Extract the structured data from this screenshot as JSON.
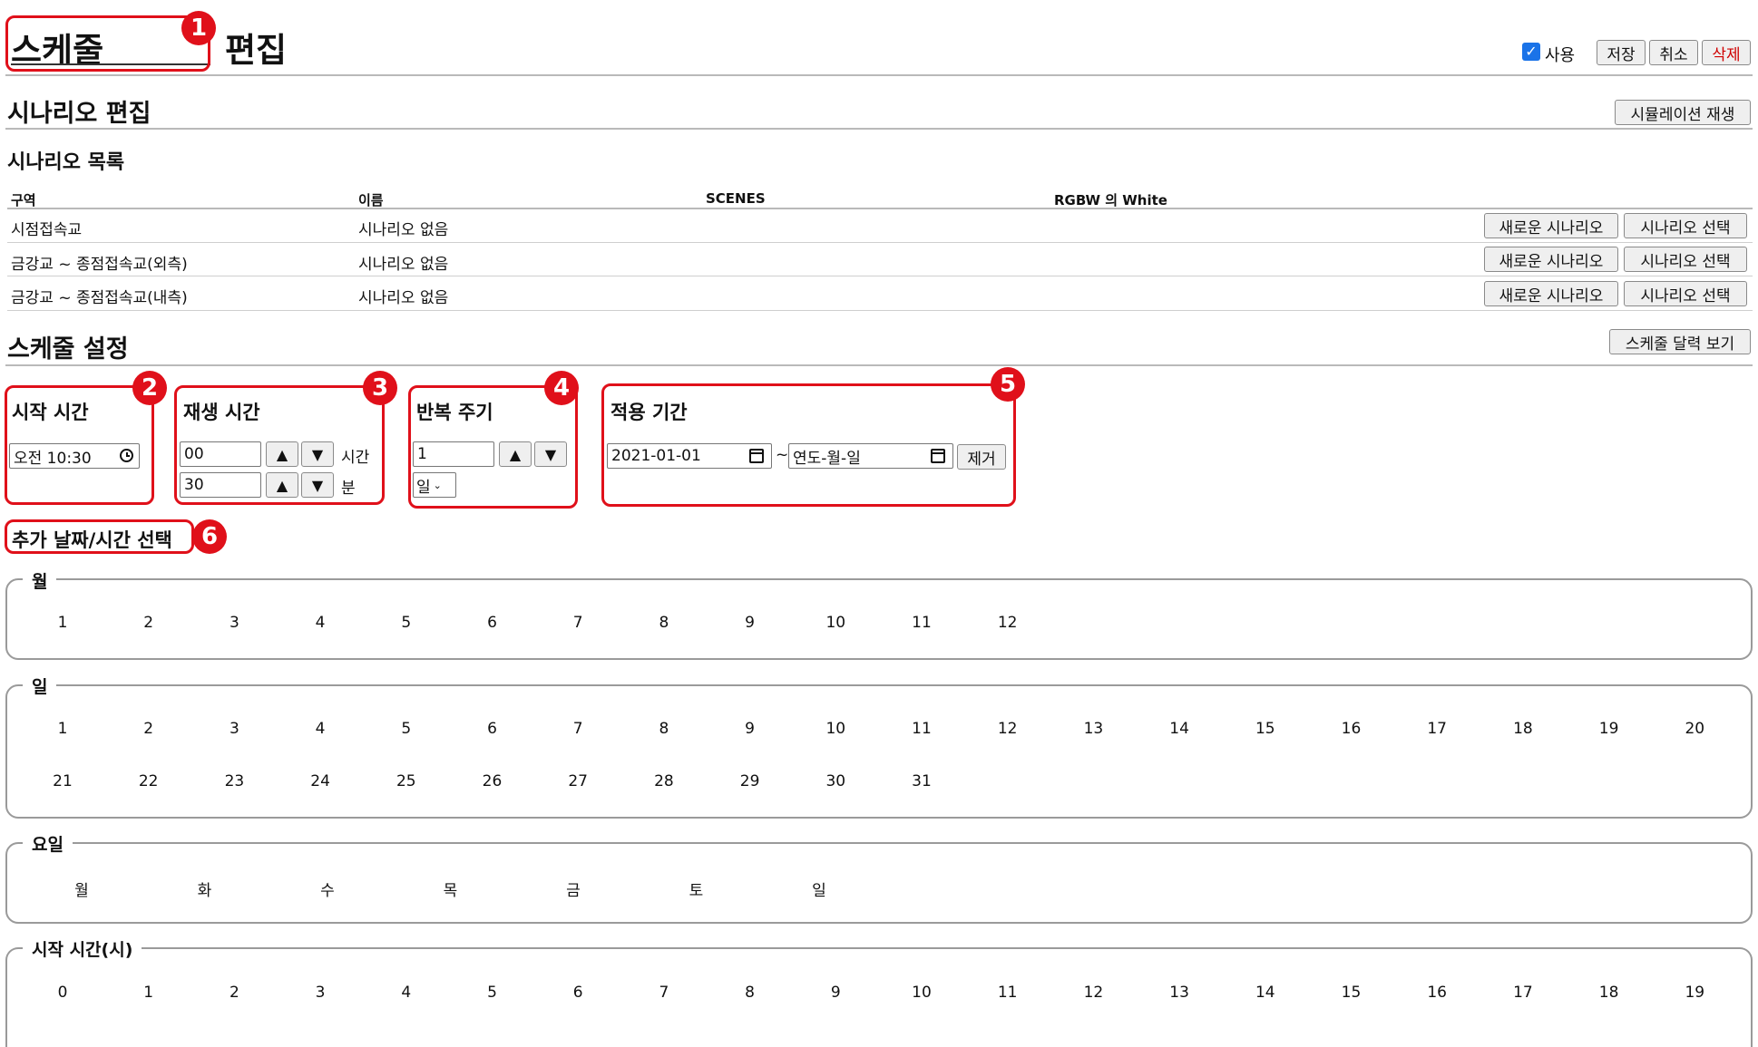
{
  "header": {
    "title_part1": "스케줄",
    "title_part2": "편집",
    "use_label": "사용",
    "save_label": "저장",
    "cancel_label": "취소",
    "delete_label": "삭제"
  },
  "scenario_edit": {
    "title": "시나리오 편집",
    "simulate_label": "시뮬레이션 재생"
  },
  "scenario_list": {
    "title": "시나리오 목록",
    "columns": [
      "구역",
      "이름",
      "SCENES",
      "RGBW 의 White"
    ],
    "rows": [
      {
        "zone": "시점접속교",
        "name": "시나리오 없음"
      },
      {
        "zone": "금강교 ~ 종점접속교(외측)",
        "name": "시나리오 없음"
      },
      {
        "zone": "금강교 ~ 종점접속교(내측)",
        "name": "시나리오 없음"
      }
    ],
    "new_scenario_label": "새로운 시나리오",
    "select_scenario_label": "시나리오 선택"
  },
  "schedule": {
    "title": "스케줄 설정",
    "calendar_label": "스케줄 달력 보기",
    "start_time": {
      "label": "시작 시간",
      "value": "오전 10:30"
    },
    "play_time": {
      "label": "재생 시간",
      "hours_value": "00",
      "hours_unit": "시간",
      "minutes_value": "30",
      "minutes_unit": "분",
      "up_symbol": "▲",
      "down_symbol": "▼"
    },
    "repeat": {
      "label": "반복 주기",
      "value": "1",
      "unit_selected": "일"
    },
    "period": {
      "label": "적용 기간",
      "start_value": "2021-01-01",
      "separator": "~",
      "end_placeholder": "연도-월-일",
      "remove_label": "제거"
    }
  },
  "extra": {
    "title": "추가 날짜/시간 선택",
    "month": {
      "legend": "월",
      "items": [
        "1",
        "2",
        "3",
        "4",
        "5",
        "6",
        "7",
        "8",
        "9",
        "10",
        "11",
        "12"
      ]
    },
    "day": {
      "legend": "일",
      "items": [
        "1",
        "2",
        "3",
        "4",
        "5",
        "6",
        "7",
        "8",
        "9",
        "10",
        "11",
        "12",
        "13",
        "14",
        "15",
        "16",
        "17",
        "18",
        "19",
        "20",
        "21",
        "22",
        "23",
        "24",
        "25",
        "26",
        "27",
        "28",
        "29",
        "30",
        "31"
      ]
    },
    "weekday": {
      "legend": "요일",
      "items": [
        "월",
        "화",
        "수",
        "목",
        "금",
        "토",
        "일"
      ]
    },
    "start_hour": {
      "legend": "시작 시간(시)",
      "items": [
        "0",
        "1",
        "2",
        "3",
        "4",
        "5",
        "6",
        "7",
        "8",
        "9",
        "10",
        "11",
        "12",
        "13",
        "14",
        "15",
        "16",
        "17",
        "18",
        "19"
      ]
    }
  },
  "badges": [
    "1",
    "2",
    "3",
    "4",
    "5",
    "6"
  ],
  "colors": {
    "annotation": "#e0101a",
    "checkbox": "#1a73e8",
    "delete_text": "#d00000"
  },
  "icons": [
    "checkbox-checked-icon",
    "clock-icon",
    "calendar-icon",
    "select-arrow-icon"
  ]
}
